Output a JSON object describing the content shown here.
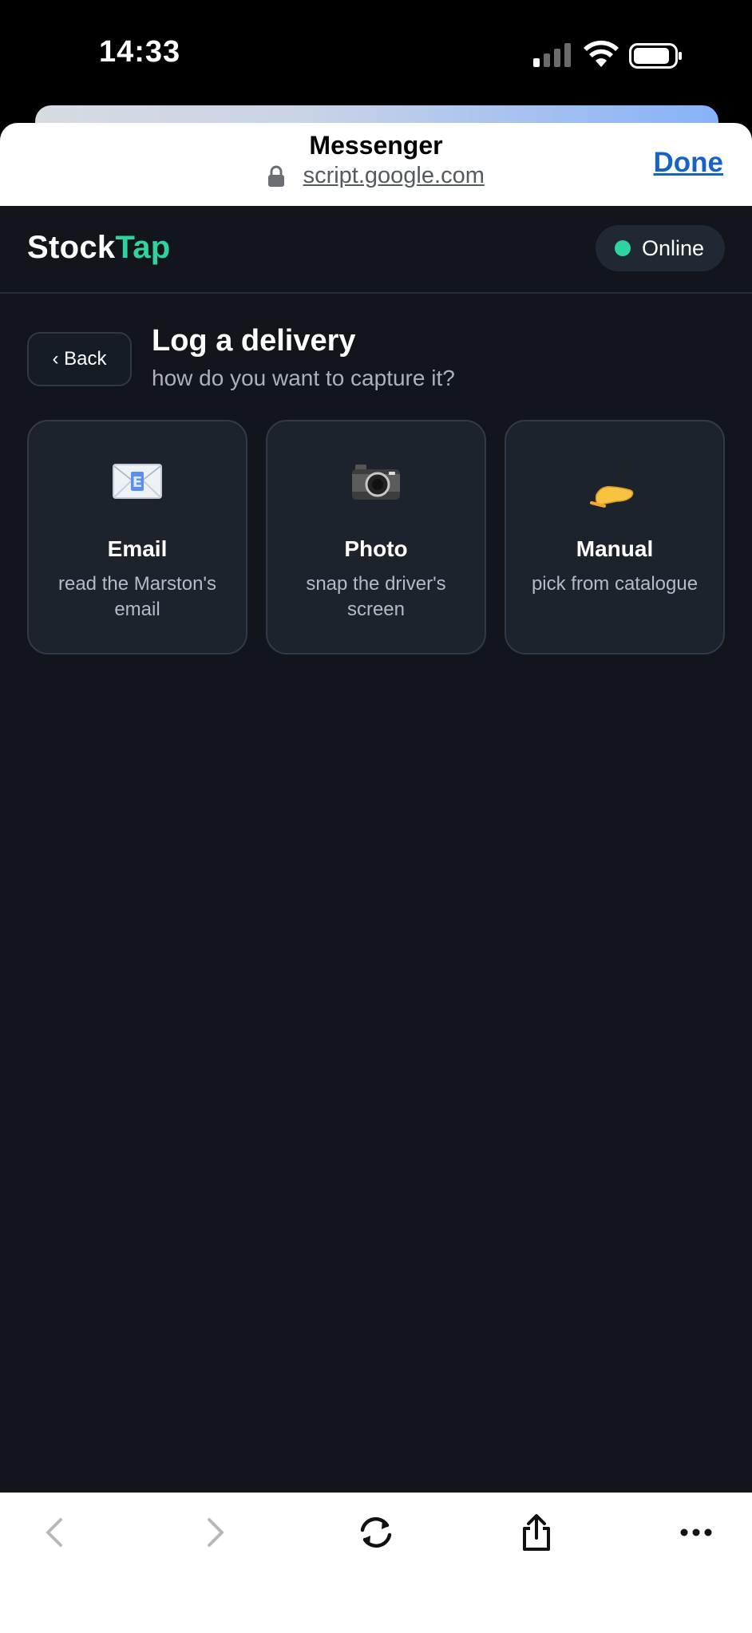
{
  "status_bar": {
    "time": "14:33"
  },
  "browser": {
    "title": "Messenger",
    "url": "script.google.com",
    "done_label": "Done"
  },
  "app": {
    "logo": {
      "part1": "Stock",
      "part2": "Tap"
    },
    "status": "Online",
    "back_label": "‹ Back",
    "title": "Log a delivery",
    "subtitle": "how do you want to capture it?",
    "options": [
      {
        "title": "Email",
        "description": "read the Marston's email",
        "icon": "email-icon"
      },
      {
        "title": "Photo",
        "description": "snap the driver's screen",
        "icon": "camera-icon"
      },
      {
        "title": "Manual",
        "description": "pick from catalogue",
        "icon": "writing-hand-icon"
      }
    ]
  },
  "toolbar": {
    "items": [
      "back-icon",
      "forward-icon",
      "reload-icon",
      "share-icon",
      "more-icon"
    ]
  },
  "colors": {
    "app_background": "#12161c",
    "card_background": "#1c232d",
    "accent": "#2ed3a0",
    "done_link": "#1762c9"
  }
}
